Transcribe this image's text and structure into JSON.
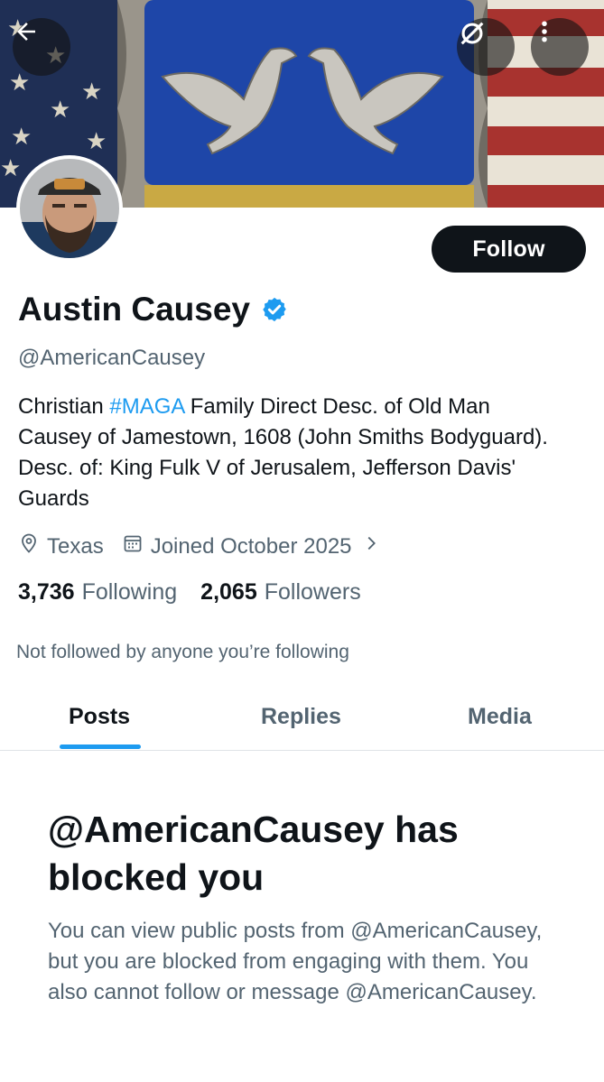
{
  "header": {
    "back_icon": "arrow-left-icon",
    "translate_icon": "translate-icon",
    "more_icon": "more-vertical-icon"
  },
  "profile": {
    "display_name": "Austin Causey",
    "verified": true,
    "verified_color": "#1d9bf0",
    "handle": "@AmericanCausey",
    "follow_label": "Follow",
    "bio_before": "Christian ",
    "bio_hashtag": "#MAGA",
    "bio_after": " Family Direct Desc. of Old Man Causey of Jamestown, 1608 (John Smiths Bodyguard). Desc. of: King Fulk V of Jerusalem, Jefferson Davis' Guards",
    "location": "Texas",
    "joined": "Joined October 2025",
    "following_count": "3,736",
    "following_label": "Following",
    "followers_count": "2,065",
    "followers_label": "Followers",
    "mutuals_note": "Not followed by anyone you’re following"
  },
  "tabs": [
    {
      "label": "Posts",
      "active": true
    },
    {
      "label": "Replies",
      "active": false
    },
    {
      "label": "Media",
      "active": false
    }
  ],
  "blocked": {
    "title": "@AmericanCausey has blocked you",
    "body": "You can view public posts from @AmericanCausey, but you are blocked from engaging with them. You also cannot follow or message @AmericanCausey."
  },
  "colors": {
    "accent": "#1d9bf0",
    "text_primary": "#0f1419",
    "text_secondary": "#536471"
  }
}
